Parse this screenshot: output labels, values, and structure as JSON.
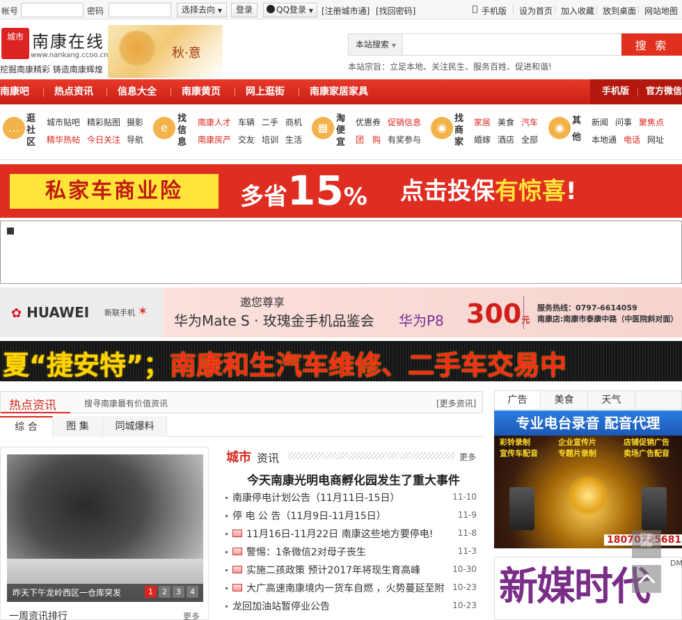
{
  "topbar": {
    "account_label": "帐号",
    "password_label": "密码",
    "goto_label": "选择去向",
    "login_label": "登录",
    "qq_login_label": "QQ登录",
    "register_link": "[注册城市通]",
    "recover_link": "[找回密码]",
    "links": [
      "手机版",
      "设为首页",
      "加入收藏",
      "放到桌面",
      "网站地图"
    ]
  },
  "header": {
    "logo_text": "城市",
    "site_name": "南康在线",
    "site_url": "www.nankang.ccoo.cn",
    "slogan": "挖掘南康精彩 铸造南康辉煌",
    "autumn_text": "秋·意",
    "search_scope": "本站搜索",
    "search_button": "搜 索",
    "tagline": "本站宗旨：立足本地、关注民生、服务百姓、促进和谐!"
  },
  "nav": {
    "items": [
      "南康吧",
      "热点资讯",
      "信息大全",
      "南康黄页",
      "网上逛街",
      "南康家居家具"
    ],
    "right_items": [
      "手机版",
      "官方微信"
    ]
  },
  "categories": {
    "community": {
      "title": "逛社区",
      "links": [
        {
          "text": "城市贴吧",
          "hot": false
        },
        {
          "text": "精彩贴图",
          "hot": false
        },
        {
          "text": "摄影",
          "hot": false
        },
        {
          "text": "精华热帖",
          "hot": true
        },
        {
          "text": "今日关注",
          "hot": true
        },
        {
          "text": "导航",
          "hot": false
        }
      ]
    },
    "info": {
      "title": "找信息",
      "links": [
        {
          "text": "南康人才",
          "hot": true
        },
        {
          "text": "车辆",
          "hot": false
        },
        {
          "text": "二手",
          "hot": false
        },
        {
          "text": "商机",
          "hot": false
        },
        {
          "text": "南康房产",
          "hot": true
        },
        {
          "text": "交友",
          "hot": false
        },
        {
          "text": "培训",
          "hot": false
        },
        {
          "text": "生活",
          "hot": false
        }
      ]
    },
    "deals": {
      "title": "淘便宜",
      "links": [
        {
          "text": "优惠券",
          "hot": false
        },
        {
          "text": "促销信息",
          "hot": true
        },
        {
          "text": "团　购",
          "hot": true
        },
        {
          "text": "有奖参与",
          "hot": false
        }
      ]
    },
    "merchants": {
      "title": "找商家",
      "links": [
        {
          "text": "家居",
          "hot": true
        },
        {
          "text": "美食",
          "hot": false
        },
        {
          "text": "汽车",
          "hot": true
        },
        {
          "text": "婚嫁",
          "hot": false
        },
        {
          "text": "酒店",
          "hot": false
        },
        {
          "text": "全部",
          "hot": false
        }
      ]
    },
    "other": {
      "title": "其他",
      "links": [
        {
          "text": "新闻",
          "hot": false
        },
        {
          "text": "问事",
          "hot": false
        },
        {
          "text": "聚焦点",
          "hot": true
        },
        {
          "text": "本地通",
          "hot": false
        },
        {
          "text": "电话",
          "hot": true
        },
        {
          "text": "网址",
          "hot": false
        }
      ]
    }
  },
  "banners": {
    "insurance": {
      "left": "私家车商业险",
      "mid_pre": "多省",
      "mid_num": "15",
      "mid_post": "%",
      "right_pre": "点击投保",
      "right_hl": "有惊喜",
      "right_post": "!"
    },
    "huawei": {
      "brand": "HUAWEI",
      "dealer": "新联手机",
      "line1": "邀您尊享",
      "line2": "华为Mate S · 玫瑰金手机品鉴会",
      "line3": "华为P8",
      "price": "300",
      "price_unit": "元",
      "hotline": "服务热线：0797-6614059",
      "address": "南康店:南康市泰康中路（中医院斜对面）"
    },
    "marquee": {
      "part1": "夏“捷安特”；",
      "part2": "南康和生汽车维修、二手车交易中"
    }
  },
  "hot": {
    "title": "热点资讯",
    "subtitle": "搜寻南康最有价值资讯",
    "more": "[更多资讯]",
    "tabs": [
      "综 合",
      "图 集",
      "同城爆料"
    ],
    "photo_caption": "昨天下午龙岭西区一仓库突发",
    "pages": [
      "1",
      "2",
      "3",
      "4"
    ],
    "week_title": "一周资讯排行",
    "week_more": "更多"
  },
  "city": {
    "title": "城市",
    "title2": "资讯",
    "more": "更多",
    "headline": "今天南康光明电商孵化园发生了重大事件",
    "items": [
      {
        "text": "南康停电计划公告（11月11日-15日）",
        "date": "11-10",
        "pic": false
      },
      {
        "text": "停 电 公 告（11月9日-11月15日）",
        "date": "11-9",
        "pic": false
      },
      {
        "text": "11月16日-11月22日 南康这些地方要停电!",
        "date": "11-8",
        "pic": true
      },
      {
        "text": "警惕：1条微信2对母子丧生",
        "date": "11-3",
        "pic": true
      },
      {
        "text": "实施二孩政策 预计2017年将现生育高峰",
        "date": "10-30",
        "pic": true
      },
      {
        "text": "大广高速南康境内一货车自燃 ，火势蔓延至附",
        "date": "10-23",
        "pic": true
      },
      {
        "text": "龙回加油站暂停业公告",
        "date": "10-23",
        "pic": false
      }
    ]
  },
  "right": {
    "tabs": [
      "广告",
      "美食",
      "天气"
    ],
    "ad1": {
      "heading": "专业电台录音  配音代理",
      "g1": "彩铃录制\n宣传车配音",
      "g2": "企业宣传片\n专题片录制",
      "g3": "店铺促销广告\n卖场广告配音",
      "phone": "18070725681"
    },
    "ad2": {
      "text": "新媒时代",
      "dm": "DM"
    },
    "float_label": "回到\n顶部"
  }
}
